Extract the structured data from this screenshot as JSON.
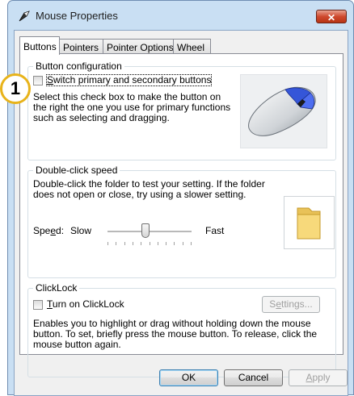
{
  "window": {
    "title": "Mouse Properties",
    "close_icon": "close-icon",
    "title_icon": "mouse-pointer-icon"
  },
  "tabs": [
    {
      "label": "Buttons",
      "active": true
    },
    {
      "label": "Pointers",
      "active": false
    },
    {
      "label": "Pointer Options",
      "active": false
    },
    {
      "label": "Wheel",
      "active": false
    }
  ],
  "callout": {
    "number": "1",
    "color": "#e8b31a"
  },
  "button_configuration": {
    "title": "Button configuration",
    "checkbox_label": "Switch primary and secondary buttons",
    "checkbox_mnemonic": "S",
    "checked": false,
    "description": "Select this check box to make the button on the right the one you use for primary functions such as selecting and dragging.",
    "image_icon": "mouse-icon"
  },
  "double_click": {
    "title": "Double-click speed",
    "description": "Double-click the folder to test your setting. If the folder does not open or close, try using a slower setting.",
    "speed_label": "Speed:",
    "speed_mnemonic": "e",
    "slow_label": "Slow",
    "fast_label": "Fast",
    "slider_value_fraction": 0.45,
    "tick_count": 11,
    "folder_icon": "folder-icon"
  },
  "clicklock": {
    "title": "ClickLock",
    "checkbox_label": "Turn on ClickLock",
    "checkbox_mnemonic": "T",
    "checked": false,
    "settings_button": "Settings...",
    "settings_enabled": false,
    "description": "Enables you to highlight or drag without holding down the mouse button. To set, briefly press the mouse button. To release, click the mouse button again."
  },
  "footer": {
    "ok": "OK",
    "cancel": "Cancel",
    "apply": "Apply",
    "apply_enabled": false
  }
}
